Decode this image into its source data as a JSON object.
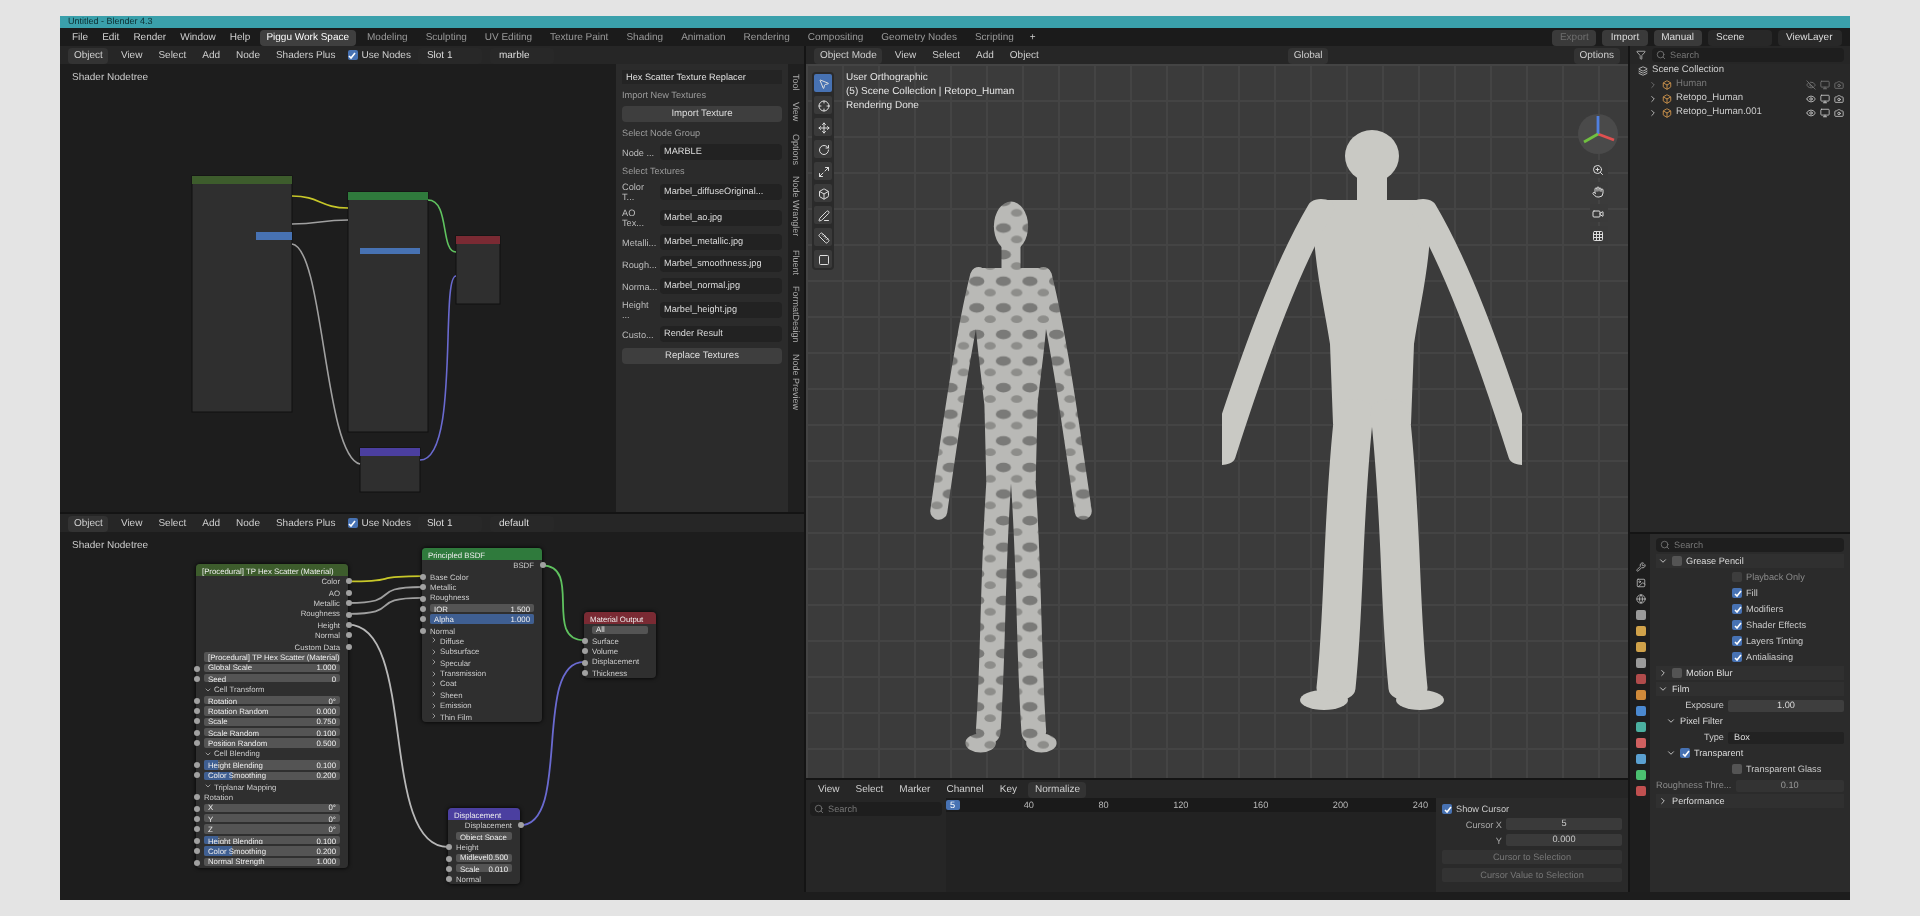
{
  "window": {
    "title": "Untitled - Blender 4.3"
  },
  "menus": [
    "File",
    "Edit",
    "Render",
    "Window",
    "Help"
  ],
  "workspaces": [
    {
      "label": "Piggu Work Space",
      "selected": true
    },
    {
      "label": "Modeling",
      "selected": false
    },
    {
      "label": "Sculpting",
      "selected": false
    },
    {
      "label": "UV Editing",
      "selected": false
    },
    {
      "label": "Texture Paint",
      "selected": false
    },
    {
      "label": "Shading",
      "selected": false
    },
    {
      "label": "Animation",
      "selected": false
    },
    {
      "label": "Rendering",
      "selected": false
    },
    {
      "label": "Compositing",
      "selected": false
    },
    {
      "label": "Geometry Nodes",
      "selected": false
    },
    {
      "label": "Scripting",
      "selected": false
    }
  ],
  "add_workspace": "+",
  "top_buttons": [
    {
      "label": "Export",
      "disabled": true
    },
    {
      "label": "Import",
      "disabled": false
    },
    {
      "label": "Manual",
      "disabled": false
    }
  ],
  "scene": "Scene",
  "view_layer": "ViewLayer",
  "node_editor_top": {
    "mode": "Object",
    "menus": [
      "View",
      "Select",
      "Add",
      "Node",
      "Shaders Plus"
    ],
    "use_nodes": {
      "label": "Use Nodes",
      "checked": true
    },
    "slot": "Slot 1",
    "material": "marble",
    "tree_label": "Shader Nodetree"
  },
  "addon_panel": {
    "title": "Hex Scatter Texture Replacer",
    "import_label": "Import New Textures",
    "import_button": "Import Texture",
    "group_label": "Select Node Group",
    "group_field": {
      "label": "Node ...",
      "value": "MARBLE"
    },
    "textures_label": "Select Textures",
    "textures": [
      {
        "label": "Color T...",
        "value": "Marbel_diffuseOriginal..."
      },
      {
        "label": "AO Tex...",
        "value": "Marbel_ao.jpg"
      },
      {
        "label": "Metalli...",
        "value": "Marbel_metallic.jpg"
      },
      {
        "label": "Rough...",
        "value": "Marbel_smoothness.jpg"
      },
      {
        "label": "Norma...",
        "value": "Marbel_normal.jpg"
      },
      {
        "label": "Height ...",
        "value": "Marbel_height.jpg"
      },
      {
        "label": "Custo...",
        "value": "Render Result"
      }
    ],
    "replace_button": "Replace Textures"
  },
  "side_tabs": [
    "Tool",
    "View",
    "Options",
    "Node Wrangler",
    "Fluent",
    "FormatDesign",
    "Node Preview"
  ],
  "node_editor_bottom": {
    "mode": "Object",
    "menus": [
      "View",
      "Select",
      "Add",
      "Node",
      "Shaders Plus"
    ],
    "use_nodes": {
      "label": "Use Nodes",
      "checked": true
    },
    "slot": "Slot 1",
    "material": "default",
    "tree_label": "Shader Nodetree",
    "nodes": [
      {
        "title": "[Procedural] TP Hex Scatter (Material)",
        "color": "#3d5c2c",
        "rows": [
          {
            "kind": "output",
            "label": "Color"
          },
          {
            "kind": "output",
            "label": "AO"
          },
          {
            "kind": "output",
            "label": "Metallic"
          },
          {
            "kind": "output",
            "label": "Roughness"
          },
          {
            "kind": "output",
            "label": "Height"
          },
          {
            "kind": "output",
            "label": "Normal"
          },
          {
            "kind": "output",
            "label": "Custom Data"
          },
          {
            "kind": "group",
            "label": "[Procedural] TP Hex Scatter (Material)"
          },
          {
            "kind": "value",
            "label": "Global Scale",
            "value": "1.000"
          },
          {
            "kind": "value",
            "label": "Seed",
            "value": "0"
          },
          {
            "kind": "section",
            "label": "Cell Transform",
            "expanded": true
          },
          {
            "kind": "value",
            "label": "Rotation",
            "value": "0°"
          },
          {
            "kind": "value",
            "label": "Rotation Random",
            "value": "0.000"
          },
          {
            "kind": "value",
            "label": "Scale",
            "value": "0.750"
          },
          {
            "kind": "value",
            "label": "Scale Random",
            "value": "0.100"
          },
          {
            "kind": "value",
            "label": "Position Random",
            "value": "0.500"
          },
          {
            "kind": "section",
            "label": "Cell Blending",
            "expanded": true
          },
          {
            "kind": "slider",
            "label": "Height Blending",
            "value": "0.100",
            "level": 0.1
          },
          {
            "kind": "slider",
            "label": "Color Smoothing",
            "value": "0.200",
            "level": 0.2
          },
          {
            "kind": "section",
            "label": "Triplanar Mapping",
            "expanded": true
          },
          {
            "kind": "input",
            "label": "Rotation"
          },
          {
            "kind": "value",
            "label": "X",
            "value": "0°"
          },
          {
            "kind": "value",
            "label": "Y",
            "value": "0°"
          },
          {
            "kind": "value",
            "label": "Z",
            "value": "0°"
          },
          {
            "kind": "slider",
            "label": "Height Blending",
            "value": "0.100",
            "level": 0.1
          },
          {
            "kind": "slider",
            "label": "Color Smoothing",
            "value": "0.200",
            "level": 0.2
          },
          {
            "kind": "value",
            "label": "Normal Strength",
            "value": "1.000"
          }
        ]
      },
      {
        "title": "Principled BSDF",
        "color": "#2f7a3c",
        "rows": [
          {
            "kind": "output",
            "label": "BSDF"
          },
          {
            "kind": "input",
            "label": "Base Color"
          },
          {
            "kind": "input",
            "label": "Metallic"
          },
          {
            "kind": "input",
            "label": "Roughness"
          },
          {
            "kind": "value",
            "label": "IOR",
            "value": "1.500"
          },
          {
            "kind": "slider",
            "label": "Alpha",
            "value": "1.000",
            "level": 1
          },
          {
            "kind": "input",
            "label": "Normal"
          },
          {
            "kind": "section",
            "label": "Diffuse",
            "expanded": false
          },
          {
            "kind": "section",
            "label": "Subsurface",
            "expanded": false
          },
          {
            "kind": "section",
            "label": "Specular",
            "expanded": false
          },
          {
            "kind": "section",
            "label": "Transmission",
            "expanded": false
          },
          {
            "kind": "section",
            "label": "Coat",
            "expanded": false
          },
          {
            "kind": "section",
            "label": "Sheen",
            "expanded": false
          },
          {
            "kind": "section",
            "label": "Emission",
            "expanded": false
          },
          {
            "kind": "section",
            "label": "Thin Film",
            "expanded": false
          }
        ]
      },
      {
        "title": "Material Output",
        "color": "#7a2a33",
        "rows": [
          {
            "kind": "dropdown",
            "label": "All"
          },
          {
            "kind": "input",
            "label": "Surface"
          },
          {
            "kind": "input",
            "label": "Volume"
          },
          {
            "kind": "input",
            "label": "Displacement"
          },
          {
            "kind": "input",
            "label": "Thickness"
          }
        ]
      },
      {
        "title": "Displacement",
        "color": "#4b3fa0",
        "rows": [
          {
            "kind": "output",
            "label": "Displacement"
          },
          {
            "kind": "dropdown",
            "label": "Object Space"
          },
          {
            "kind": "input",
            "label": "Height"
          },
          {
            "kind": "value",
            "label": "Midlevel",
            "value": "0.500"
          },
          {
            "kind": "value",
            "label": "Scale",
            "value": "0.010"
          },
          {
            "kind": "input",
            "label": "Normal"
          }
        ]
      }
    ]
  },
  "viewport": {
    "mode": "Object Mode",
    "menus": [
      "View",
      "Select",
      "Add",
      "Object"
    ],
    "orientation": "Global",
    "options": "Options",
    "overlay": [
      "User Orthographic",
      "(5) Scene Collection | Retopo_Human",
      "Rendering Done"
    ]
  },
  "timeline": {
    "menus": [
      "View",
      "Select",
      "Marker",
      "Channel",
      "Key"
    ],
    "normalize": "Normalize",
    "search_placeholder": "Search",
    "current_frame": "5",
    "frame_ticks": [
      "40",
      "80",
      "120",
      "160",
      "200",
      "240"
    ],
    "show_cursor": {
      "label": "Show Cursor",
      "checked": true
    },
    "cursor_x": {
      "label": "Cursor X",
      "value": "5"
    },
    "cursor_y": {
      "label": "Y",
      "value": "0.000"
    },
    "buttons": [
      "Cursor to Selection",
      "Cursor Value to Selection"
    ]
  },
  "outliner": {
    "search_placeholder": "Search",
    "root": "Scene Collection",
    "items": [
      {
        "name": "Human",
        "hidden": true
      },
      {
        "name": "Retopo_Human",
        "hidden": false
      },
      {
        "name": "Retopo_Human.001",
        "hidden": false
      }
    ]
  },
  "properties": {
    "search_placeholder": "Search",
    "rows": [
      {
        "kind": "section",
        "label": "Grease Pencil",
        "expanded": true,
        "checked": false
      },
      {
        "kind": "check",
        "label": "Playback Only",
        "checked": false,
        "disabled": true
      },
      {
        "kind": "check",
        "label": "Fill",
        "checked": true,
        "disabled": false
      },
      {
        "kind": "check",
        "label": "Modifiers",
        "checked": true,
        "disabled": false
      },
      {
        "kind": "check",
        "label": "Shader Effects",
        "checked": true,
        "disabled": false
      },
      {
        "kind": "check",
        "label": "Layers Tinting",
        "checked": true,
        "disabled": false
      },
      {
        "kind": "check",
        "label": "Antialiasing",
        "checked": true,
        "disabled": false
      },
      {
        "kind": "section",
        "label": "Motion Blur",
        "expanded": false,
        "checked": false
      },
      {
        "kind": "section",
        "label": "Film",
        "expanded": true
      },
      {
        "kind": "value",
        "label": "Exposure",
        "value": "1.00",
        "disabled": false
      },
      {
        "kind": "subsection",
        "label": "Pixel Filter",
        "expanded": true
      },
      {
        "kind": "dropdown",
        "label": "Type",
        "value": "Box"
      },
      {
        "kind": "subsection",
        "label": "Transparent",
        "expanded": true,
        "checked": true
      },
      {
        "kind": "check",
        "label": "Transparent Glass",
        "checked": false,
        "disabled": false
      },
      {
        "kind": "value",
        "label": "Roughness Thre...",
        "value": "0.10",
        "disabled": true
      },
      {
        "kind": "section",
        "label": "Performance",
        "expanded": false
      }
    ]
  }
}
